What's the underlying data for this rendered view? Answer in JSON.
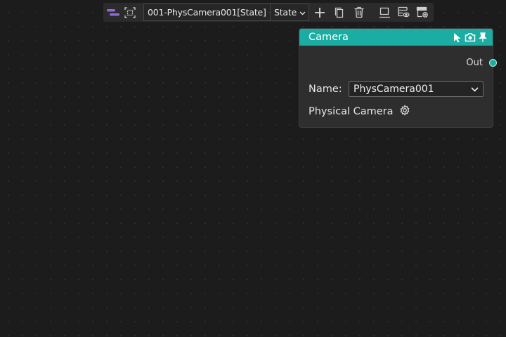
{
  "toolbar": {
    "icons": [
      "layout-icon",
      "select-frame-icon",
      "add-icon",
      "copy-icon",
      "delete-icon",
      "publish-icon",
      "state-view-icon",
      "state-settings-icon"
    ],
    "scene_select": "001-PhysCamera001[State]",
    "state_select": "State"
  },
  "node": {
    "title": "Camera",
    "header_color": "#1bada3",
    "header_icons": [
      "cursor-icon",
      "camera-icon",
      "pin-icon"
    ],
    "out_label": "Out",
    "name_label": "Name:",
    "name_value": "PhysCamera001",
    "physical_label": "Physical Camera"
  },
  "colors": {
    "background": "#1c1c1c",
    "accent": "#1bada3",
    "toolbar_accent": "#8f6bd8"
  }
}
